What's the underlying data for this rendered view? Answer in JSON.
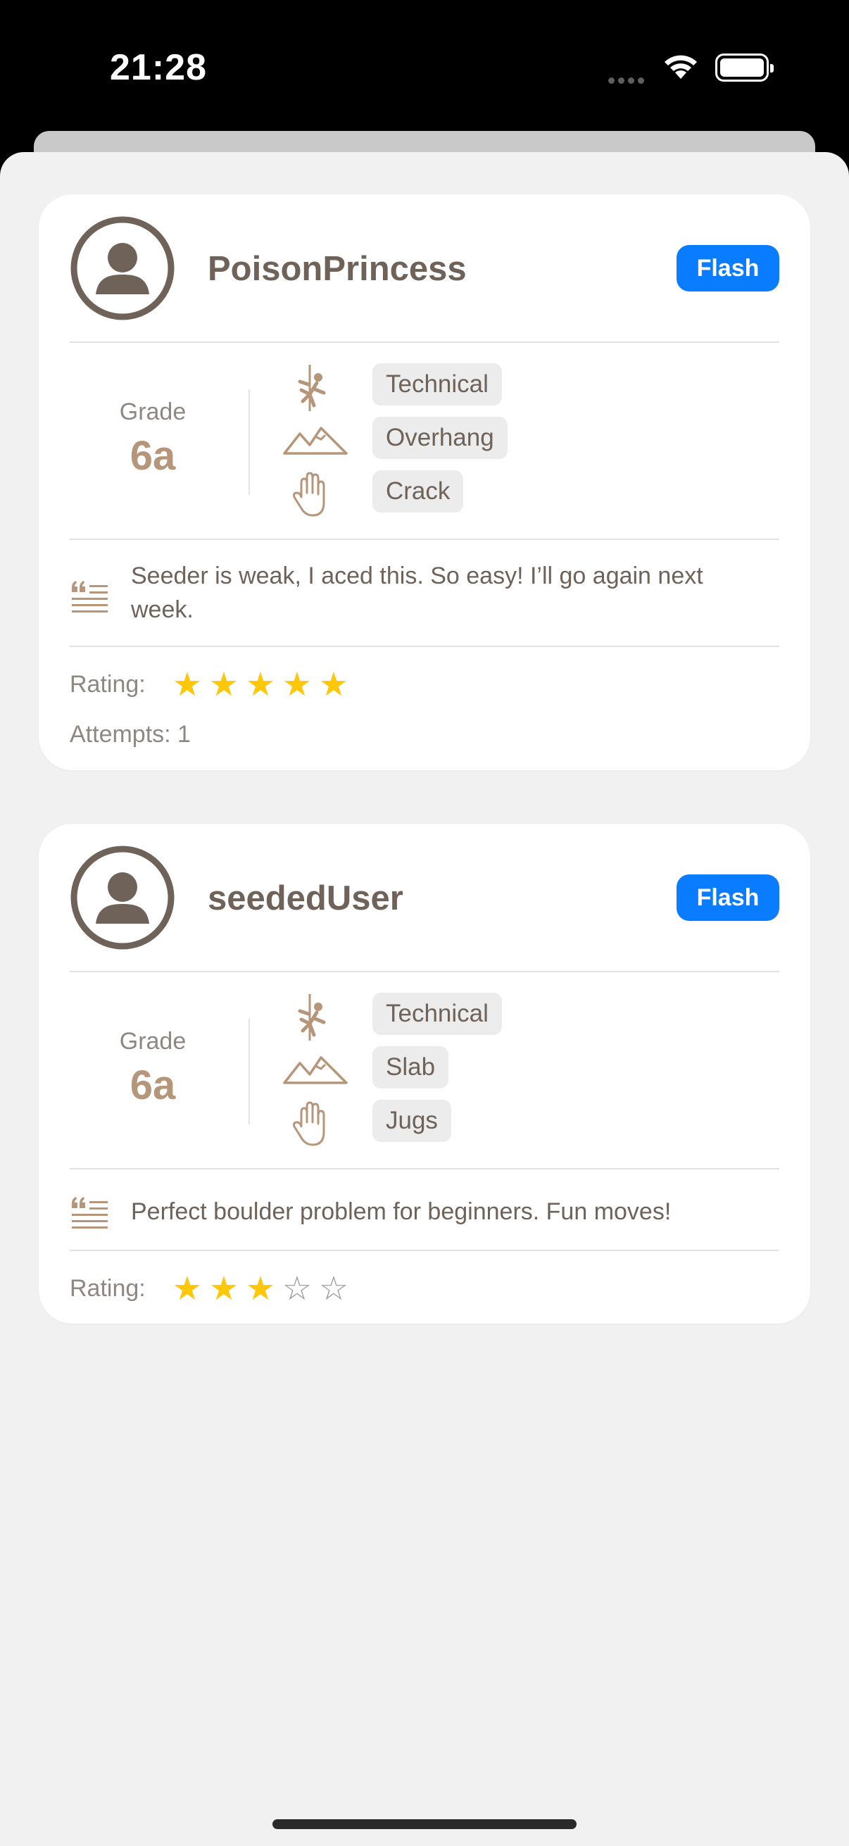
{
  "status": {
    "time": "21:28"
  },
  "colors": {
    "accent": "#0a7cff",
    "brown": "#b5967a",
    "star": "#fec70a",
    "text": "#6e6259"
  },
  "reviews": [
    {
      "username": "PoisonPrincess",
      "badge": "Flash",
      "grade_label": "Grade",
      "grade": "6a",
      "tags": [
        "Technical",
        "Overhang",
        "Crack"
      ],
      "icons": [
        "climber-icon",
        "mountains-icon",
        "hand-icon"
      ],
      "comment": "Seeder is weak, I aced this. So easy! I’ll go again next week.",
      "rating_label": "Rating:",
      "rating": 5,
      "rating_max": 5,
      "attempts": "Attempts: 1"
    },
    {
      "username": "seededUser",
      "badge": "Flash",
      "grade_label": "Grade",
      "grade": "6a",
      "tags": [
        "Technical",
        "Slab",
        "Jugs"
      ],
      "icons": [
        "climber-icon",
        "mountains-icon",
        "hand-icon"
      ],
      "comment": "Perfect boulder problem for beginners. Fun moves!",
      "rating_label": "Rating:",
      "rating": 3,
      "rating_max": 5
    }
  ]
}
